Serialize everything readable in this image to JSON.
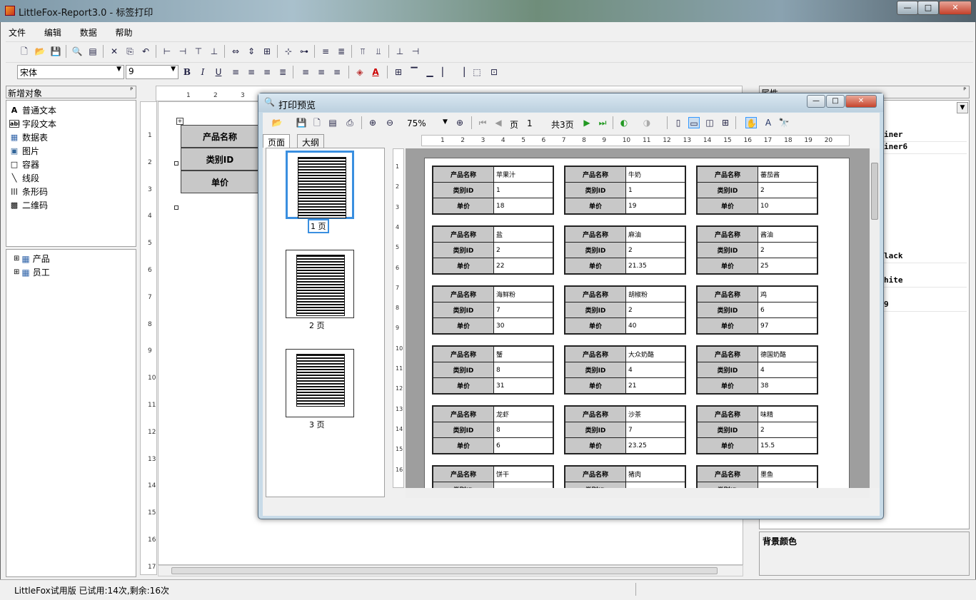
{
  "window": {
    "title": "LittleFox-Report3.0 - 标签打印",
    "minimize": "—",
    "maximize": "□",
    "close": "✕"
  },
  "menu": [
    "文件",
    "编辑",
    "数据",
    "帮助"
  ],
  "font": {
    "family": "宋体",
    "size": "9"
  },
  "format_buttons": {
    "bold": "B",
    "italic": "I",
    "underline": "U"
  },
  "new_objects": {
    "header": "新增对象",
    "pin": "ᴾ",
    "items": [
      {
        "icon": "A",
        "label": "普通文本"
      },
      {
        "icon": "abl",
        "label": "字段文本"
      },
      {
        "icon": "▦",
        "label": "数据表"
      },
      {
        "icon": "▣",
        "label": "图片"
      },
      {
        "icon": "□",
        "label": "容器"
      },
      {
        "icon": "╲",
        "label": "线段"
      },
      {
        "icon": "|||",
        "label": "条形码"
      },
      {
        "icon": "▩",
        "label": "二维码"
      }
    ]
  },
  "datasources": [
    {
      "expander": "⊞",
      "label": "产品"
    },
    {
      "expander": "⊞",
      "label": "员工"
    }
  ],
  "design": {
    "cells": [
      "产品名称",
      "类别ID",
      "单价"
    ],
    "ruler_top": [
      "1",
      "2",
      "3"
    ],
    "ruler_left": [
      "1",
      "2",
      "3",
      "4",
      "5",
      "6",
      "7",
      "8",
      "9",
      "10",
      "11",
      "12",
      "13",
      "14",
      "15",
      "16",
      "17"
    ]
  },
  "properties": {
    "header": "属性",
    "values": [
      "iner",
      "iner6",
      "lack",
      "hite",
      "9"
    ],
    "desc_title": "背景颜色"
  },
  "preview": {
    "title": "打印预览",
    "zoom": "75%",
    "page_label": "页",
    "page_value": "1",
    "total_pages": "共3页",
    "tabs": [
      "页面",
      "大纲"
    ],
    "thumbs": [
      "1 页",
      "2 页",
      "3 页"
    ],
    "ruler_top": [
      "1",
      "2",
      "3",
      "4",
      "5",
      "6",
      "7",
      "8",
      "9",
      "10",
      "11",
      "12",
      "13",
      "14",
      "15",
      "16",
      "17",
      "18",
      "19",
      "20"
    ],
    "ruler_left": [
      "1",
      "2",
      "3",
      "4",
      "5",
      "6",
      "7",
      "8",
      "9",
      "10",
      "11",
      "12",
      "13",
      "14",
      "15",
      "16"
    ],
    "field_labels": {
      "name": "产品名称",
      "category": "类别ID",
      "price": "单价"
    },
    "labels": [
      {
        "name": "苹果汁",
        "category": "1",
        "price": "18"
      },
      {
        "name": "牛奶",
        "category": "1",
        "price": "19"
      },
      {
        "name": "蕃茄酱",
        "category": "2",
        "price": "10"
      },
      {
        "name": "盐",
        "category": "2",
        "price": "22"
      },
      {
        "name": "麻油",
        "category": "2",
        "price": "21.35"
      },
      {
        "name": "酱油",
        "category": "2",
        "price": "25"
      },
      {
        "name": "海鲜粉",
        "category": "7",
        "price": "30"
      },
      {
        "name": "胡椒粉",
        "category": "2",
        "price": "40"
      },
      {
        "name": "鸡",
        "category": "6",
        "price": "97"
      },
      {
        "name": "蟹",
        "category": "8",
        "price": "31"
      },
      {
        "name": "大众奶酪",
        "category": "4",
        "price": "21"
      },
      {
        "name": "德国奶酪",
        "category": "4",
        "price": "38"
      },
      {
        "name": "龙虾",
        "category": "8",
        "price": "6"
      },
      {
        "name": "沙茶",
        "category": "7",
        "price": "23.25"
      },
      {
        "name": "味精",
        "category": "2",
        "price": "15.5"
      },
      {
        "name": "饼干",
        "category": "",
        "price": ""
      },
      {
        "name": "猪肉",
        "category": "",
        "price": ""
      },
      {
        "name": "墨鱼",
        "category": "",
        "price": ""
      }
    ]
  },
  "status": {
    "text": "LittleFox试用版 已试用:14次,剩余:16次"
  }
}
